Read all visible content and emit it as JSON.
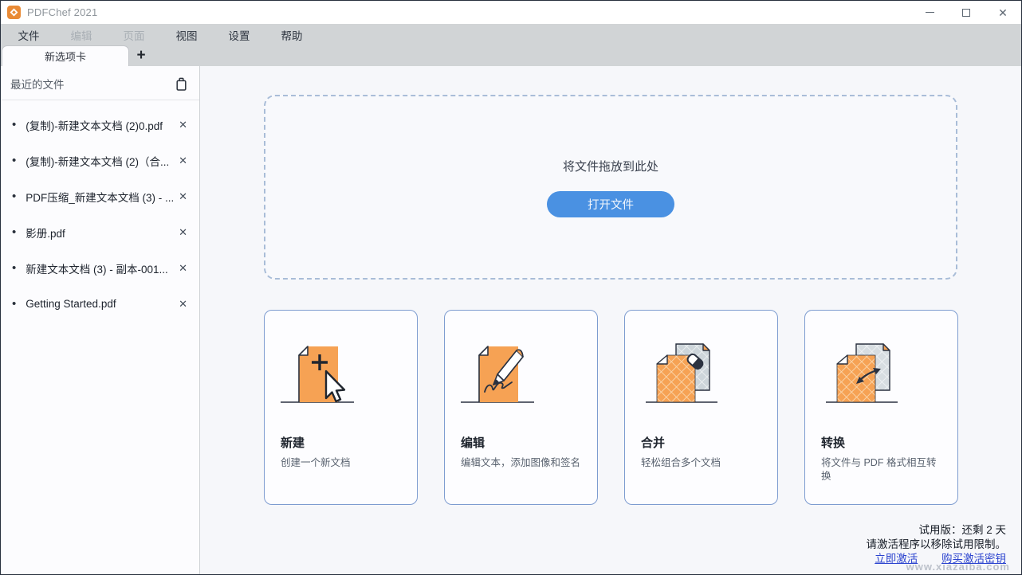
{
  "window": {
    "title": "PDFChef 2021",
    "controls": {
      "minimize": "minimize",
      "maximize": "maximize",
      "close": "✕"
    }
  },
  "menu": {
    "items": [
      {
        "label": "文件",
        "enabled": true
      },
      {
        "label": "编辑",
        "enabled": false
      },
      {
        "label": "页面",
        "enabled": false
      },
      {
        "label": "视图",
        "enabled": true
      },
      {
        "label": "设置",
        "enabled": true
      },
      {
        "label": "帮助",
        "enabled": true
      }
    ]
  },
  "tabs": {
    "active_tab": "新选项卡",
    "new_tab_button": "+"
  },
  "sidebar": {
    "header": "最近的文件",
    "trash_icon": "trash-icon",
    "bullet": "•",
    "close_glyph": "✕",
    "files": [
      {
        "name": "(复制)-新建文本文档 (2)0.pdf"
      },
      {
        "name": "(复制)-新建文本文档 (2)（合..."
      },
      {
        "name": "PDF压缩_新建文本文档 (3) - ..."
      },
      {
        "name": "影册.pdf"
      },
      {
        "name": "新建文本文档 (3) - 副本-001..."
      },
      {
        "name": "Getting Started.pdf"
      }
    ]
  },
  "dropzone": {
    "hint": "将文件拖放到此处",
    "open_button": "打开文件"
  },
  "cards": [
    {
      "title": "新建",
      "description": "创建一个新文档",
      "icon": "new-document-icon"
    },
    {
      "title": "编辑",
      "description": "编辑文本，添加图像和签名",
      "icon": "edit-document-icon"
    },
    {
      "title": "合并",
      "description": "轻松组合多个文档",
      "icon": "merge-documents-icon"
    },
    {
      "title": "转换",
      "description": "将文件与 PDF 格式相互转换",
      "icon": "convert-documents-icon"
    }
  ],
  "trial": {
    "line1": "试用版：还剩 2 天",
    "line2": "请激活程序以移除试用限制。",
    "activate_link": "立即激活",
    "buy_link": "购买激活密钥"
  },
  "watermark": "www.xiazaiba.com",
  "colors": {
    "accent_orange": "#f6a254",
    "button_blue": "#4a91e2",
    "link_blue": "#2b43cf",
    "card_border": "#7d9cd0",
    "dropzone_border": "#a9bdd8",
    "menu_bar_bg": "#d1d4d6",
    "window_border": "#27303d"
  }
}
